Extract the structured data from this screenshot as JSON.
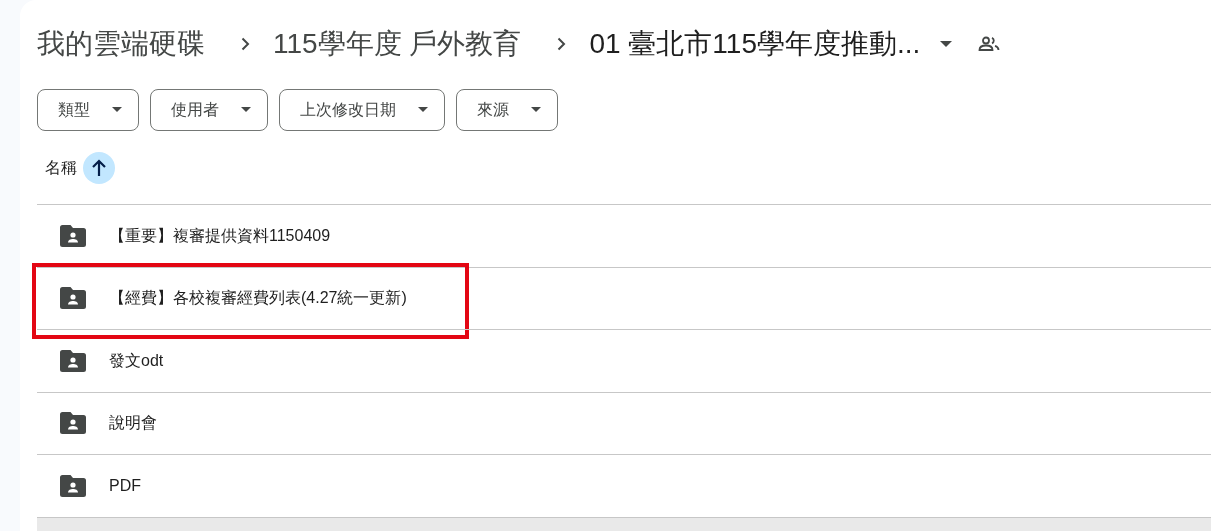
{
  "breadcrumb": [
    {
      "label": "我的雲端硬碟",
      "current": false
    },
    {
      "label": "115學年度 戶外教育",
      "current": false
    },
    {
      "label": "01 臺北市115學年度推動...",
      "current": true
    }
  ],
  "filters": [
    {
      "label": "類型"
    },
    {
      "label": "使用者"
    },
    {
      "label": "上次修改日期"
    },
    {
      "label": "來源"
    }
  ],
  "sort": {
    "label": "名稱",
    "ascending": true
  },
  "rows": [
    {
      "name": "【重要】複審提供資料1150409",
      "highlighted": false,
      "selected": false
    },
    {
      "name": "【經費】各校複審經費列表(4.27統一更新)",
      "highlighted": true,
      "selected": false
    },
    {
      "name": "發文odt",
      "highlighted": false,
      "selected": false
    },
    {
      "name": "說明會",
      "highlighted": false,
      "selected": false
    },
    {
      "name": "PDF",
      "highlighted": false,
      "selected": false
    },
    {
      "selected": true
    }
  ]
}
